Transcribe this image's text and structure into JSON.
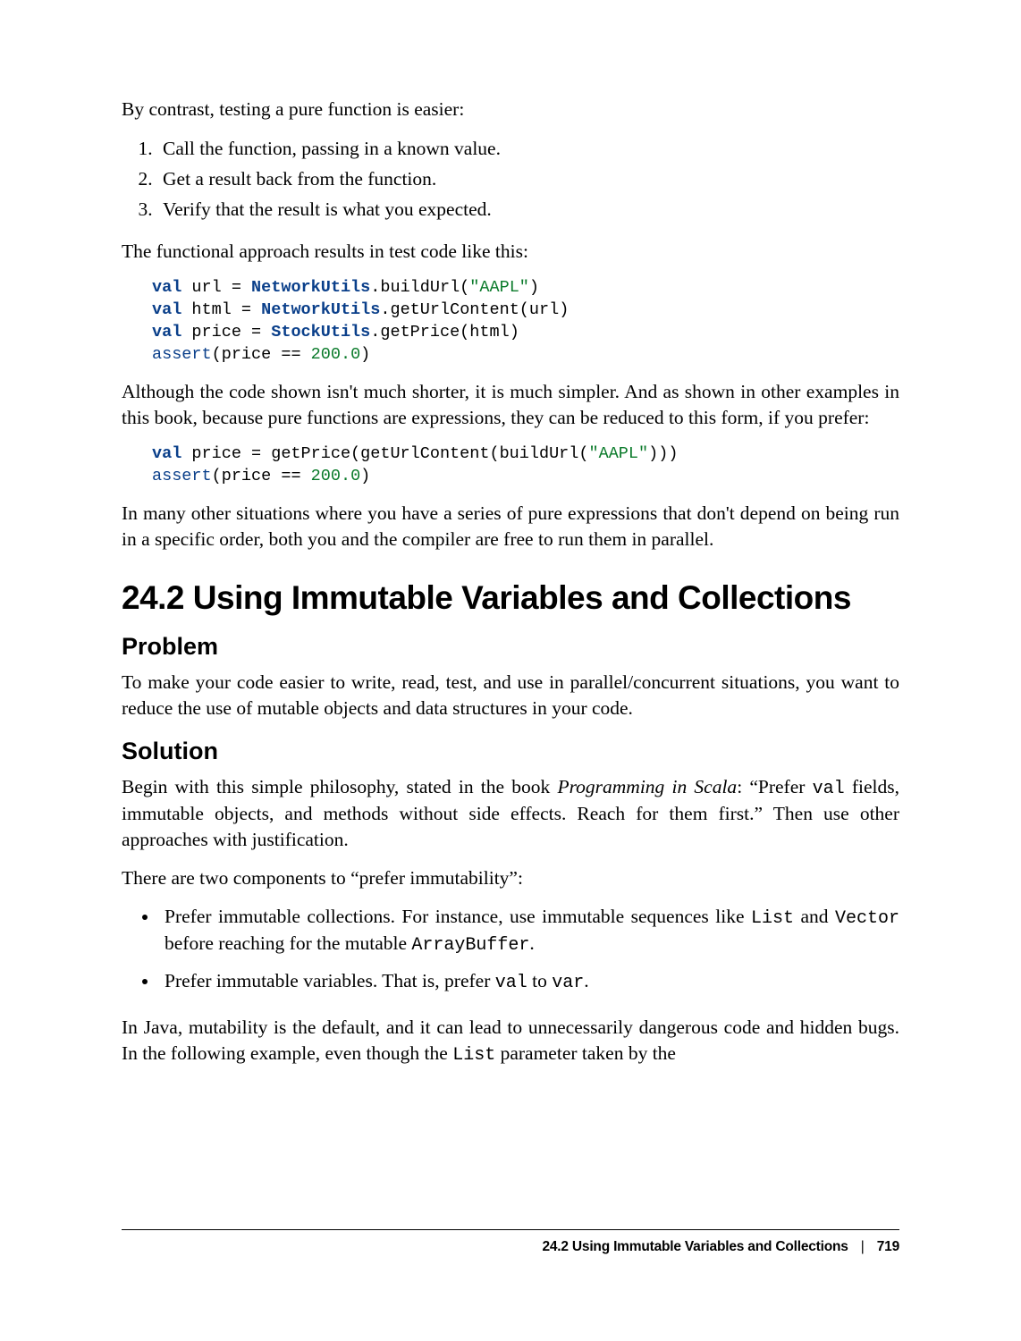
{
  "p_intro": "By contrast, testing a pure function is easier:",
  "steps": [
    "Call the function, passing in a known value.",
    "Get a result back from the function.",
    "Verify that the result is what you expected."
  ],
  "p_after_steps": "The functional approach results in test code like this:",
  "code1": {
    "l1a": "val",
    "l1b": " url = ",
    "l1c": "NetworkUtils",
    "l1d": ".buildUrl(",
    "l1e": "\"AAPL\"",
    "l1f": ")",
    "l2a": "val",
    "l2b": " html = ",
    "l2c": "NetworkUtils",
    "l2d": ".getUrlContent(url)",
    "l3a": "val",
    "l3b": " price = ",
    "l3c": "StockUtils",
    "l3d": ".getPrice(html)",
    "l4a": "assert",
    "l4b": "(price == ",
    "l4c": "200.0",
    "l4d": ")"
  },
  "p_after_code1": "Although the code shown isn't much shorter, it is much simpler. And as shown in other examples in this book, because pure functions are expressions, they can be reduced to this form, if you prefer:",
  "code2": {
    "l1a": "val",
    "l1b": " price = getPrice(getUrlContent(buildUrl(",
    "l1c": "\"AAPL\"",
    "l1d": ")))",
    "l2a": "assert",
    "l2b": "(price == ",
    "l2c": "200.0",
    "l2d": ")"
  },
  "p_after_code2": "In many other situations where you have a series of pure expressions that don't depend on being run in a specific order, both you and the compiler are free to run them in parallel.",
  "heading": "24.2 Using Immutable Variables and Collections",
  "sub_problem": "Problem",
  "p_problem": "To make your code easier to write, read, test, and use in parallel/concurrent situa­tions, you want to reduce the use of mutable objects and data structures in your code.",
  "sub_solution": "Solution",
  "p_solution_1a": "Begin with this simple philosophy, stated in the book ",
  "p_solution_1b": "Programming in Scala",
  "p_solution_1c": ": “Prefer ",
  "p_solution_1d": "val",
  "p_solution_1e": " fields, immutable objects, and methods without side effects. Reach for them first.” Then use other approaches with justification.",
  "p_components": "There are two components to “prefer immutability”:",
  "bullet1a": "Prefer immutable collections. For instance, use immutable sequences like ",
  "bullet1b": "List",
  "bullet1c": " and ",
  "bullet1d": "Vector",
  "bullet1e": " before reaching for the mutable ",
  "bullet1f": "ArrayBuffer",
  "bullet1g": ".",
  "bullet2a": "Prefer immutable variables. That is, prefer ",
  "bullet2b": "val",
  "bullet2c": " to ",
  "bullet2d": "var",
  "bullet2e": ".",
  "p_java_a": "In Java, mutability is the default, and it can lead to unnecessarily dangerous code and hidden bugs. In the following example, even though the ",
  "p_java_b": "List",
  "p_java_c": " parameter taken by the",
  "footer_title": "24.2 Using Immutable Variables and Collections",
  "footer_page": "719"
}
